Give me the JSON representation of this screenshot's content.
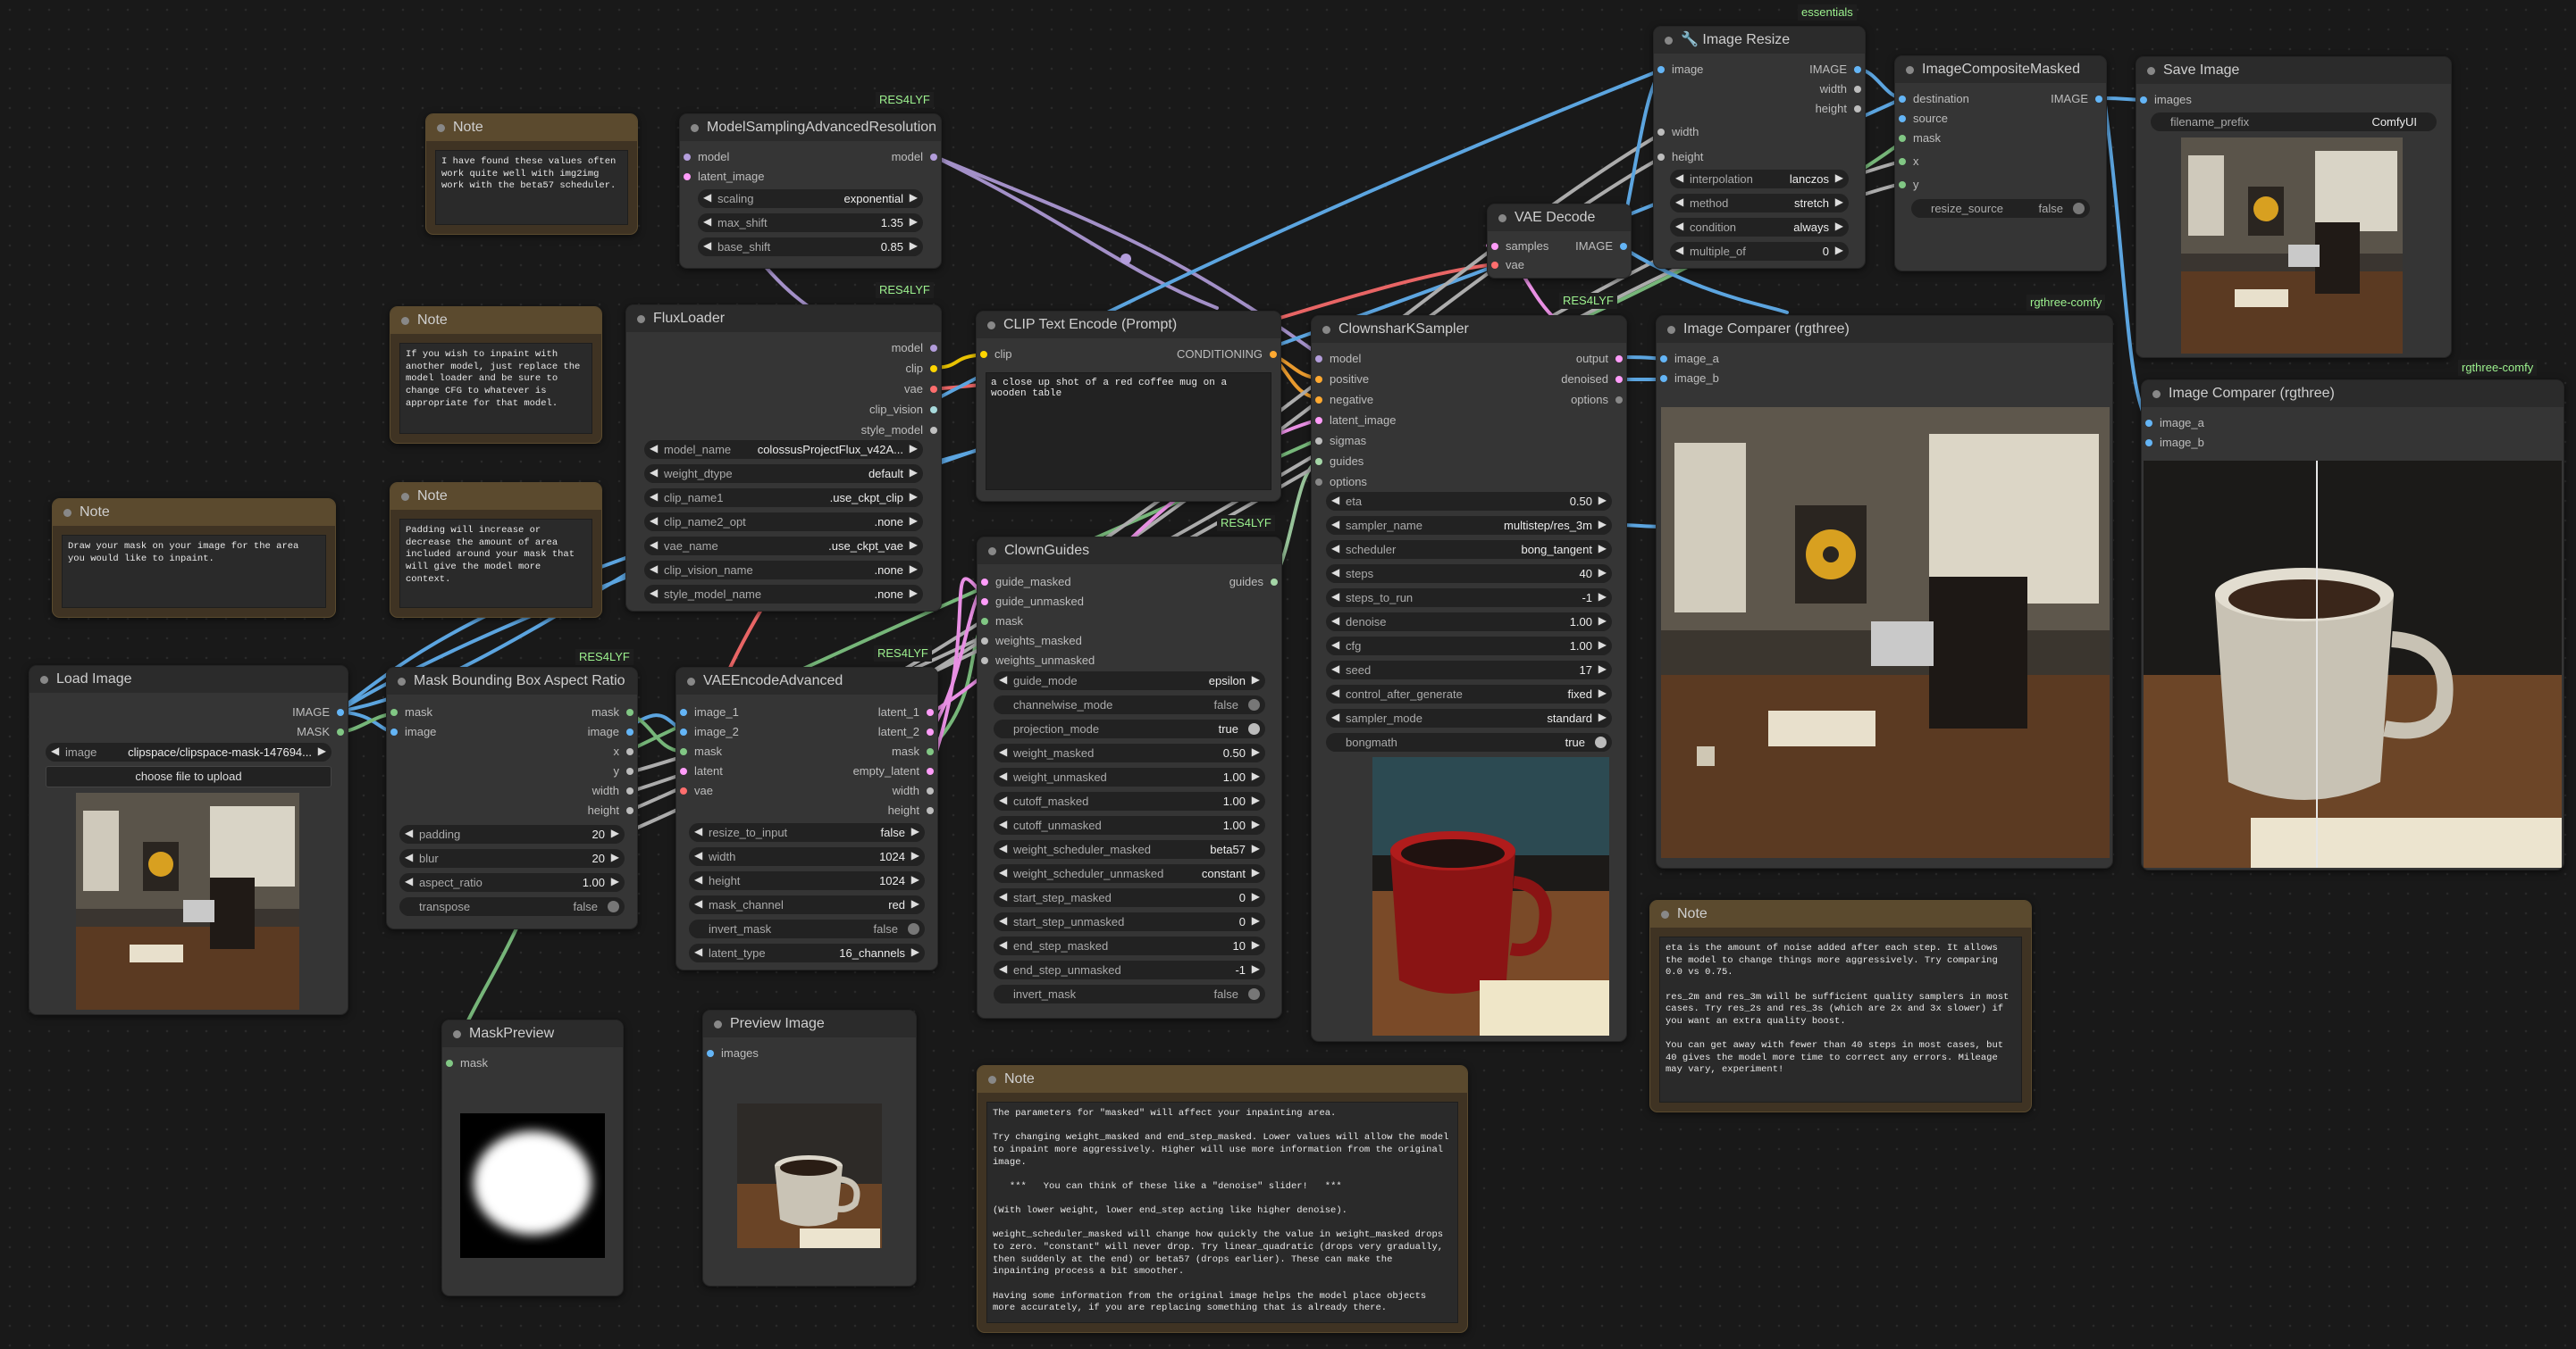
{
  "colors": {
    "image": "#64b5f6",
    "mask": "#81c784",
    "latent": "#ff9cf9",
    "model": "#b39ddb",
    "clip": "#ffd500",
    "vae": "#ff6e6e",
    "conditioning": "#ffa931",
    "guides": "#a5d6a7",
    "int": "#bdbdbd"
  },
  "badges": {
    "res4lyf_1": "RES4LYF",
    "res4lyf_2": "RES4LYF",
    "res4lyf_3": "RES4LYF",
    "res4lyf_4": "RES4LYF",
    "res4lyf_5": "RES4LYF",
    "res4lyf_6": "RES4LYF",
    "essentials": "essentials",
    "rgthree_1": "rgthree-comfy",
    "rgthree_2": "rgthree-comfy"
  },
  "notes": {
    "note1": {
      "title": "Note",
      "text": "I have found these values often work quite well with img2img work with the beta57 scheduler."
    },
    "note2": {
      "title": "Note",
      "text": "If you wish to inpaint with another model, just replace the model loader and be sure to change CFG to whatever is appropriate for that model."
    },
    "note3": {
      "title": "Note",
      "text": "Draw your mask on your image for the area you would like to inpaint."
    },
    "note4": {
      "title": "Note",
      "text": "Padding will increase or decrease the amount of area included around your mask that will give the model more context."
    },
    "note5": {
      "title": "Note",
      "text": "eta is the amount of noise added after each step. It allows the model to change things more aggressively. Try comparing 0.0 vs 0.75.\n\nres_2m and res_3m will be sufficient quality samplers in most cases. Try res_2s and res_3s (which are 2x and 3x slower) if you want an extra quality boost.\n\nYou can get away with fewer than 40 steps in most cases, but 40 gives the model more time to correct any errors. Mileage may vary, experiment!"
    },
    "note6": {
      "title": "Note",
      "text": "The parameters for \"masked\" will affect your inpainting area.\n\nTry changing weight_masked and end_step_masked. Lower values will allow the model to inpaint more aggressively. Higher will use more information from the original image.\n\n   ***   You can think of these like a \"denoise\" slider!   ***\n\n(With lower weight, lower end_step acting like higher denoise).\n\nweight_scheduler_masked will change how quickly the value in weight_masked drops to zero. \"constant\" will never drop. Try linear_quadratic (drops very gradually, then suddenly at the end) or beta57 (drops earlier). These can make the inpainting process a bit smoother.\n\nHaving some information from the original image helps the model place objects more accurately, if you are replacing something that is already there."
    }
  },
  "model_sampling": {
    "title": "ModelSamplingAdvancedResolution",
    "in_model": "model",
    "in_latent": "latent_image",
    "out_model": "model",
    "widgets": [
      {
        "label": "scaling",
        "value": "exponential"
      },
      {
        "label": "max_shift",
        "value": "1.35"
      },
      {
        "label": "base_shift",
        "value": "0.85"
      }
    ]
  },
  "flux_loader": {
    "title": "FluxLoader",
    "outputs": [
      "model",
      "clip",
      "vae",
      "clip_vision",
      "style_model"
    ],
    "widgets": [
      {
        "label": "model_name",
        "value": "colossusProjectFlux_v42A..."
      },
      {
        "label": "weight_dtype",
        "value": "default"
      },
      {
        "label": "clip_name1",
        "value": ".use_ckpt_clip"
      },
      {
        "label": "clip_name2_opt",
        "value": ".none"
      },
      {
        "label": "vae_name",
        "value": ".use_ckpt_vae"
      },
      {
        "label": "clip_vision_name",
        "value": ".none"
      },
      {
        "label": "style_model_name",
        "value": ".none"
      }
    ]
  },
  "clip_encode": {
    "title": "CLIP Text Encode (Prompt)",
    "in_clip": "clip",
    "out": "CONDITIONING",
    "text": "a close up shot of a red coffee mug on a wooden table"
  },
  "clown_guides": {
    "title": "ClownGuides",
    "inputs": [
      "guide_masked",
      "guide_unmasked",
      "mask",
      "weights_masked",
      "weights_unmasked"
    ],
    "out": "guides",
    "widgets": [
      {
        "label": "guide_mode",
        "value": "epsilon"
      },
      {
        "label": "channelwise_mode",
        "value": "false",
        "toggle": true
      },
      {
        "label": "projection_mode",
        "value": "true",
        "toggle": true
      },
      {
        "label": "weight_masked",
        "value": "0.50"
      },
      {
        "label": "weight_unmasked",
        "value": "1.00"
      },
      {
        "label": "cutoff_masked",
        "value": "1.00"
      },
      {
        "label": "cutoff_unmasked",
        "value": "1.00"
      },
      {
        "label": "weight_scheduler_masked",
        "value": "beta57"
      },
      {
        "label": "weight_scheduler_unmasked",
        "value": "constant"
      },
      {
        "label": "start_step_masked",
        "value": "0"
      },
      {
        "label": "start_step_unmasked",
        "value": "0"
      },
      {
        "label": "end_step_masked",
        "value": "10"
      },
      {
        "label": "end_step_unmasked",
        "value": "-1"
      },
      {
        "label": "invert_mask",
        "value": "false",
        "toggle": true
      }
    ]
  },
  "load_image": {
    "title": "Load Image",
    "outputs": [
      "IMAGE",
      "MASK"
    ],
    "image_label": "image",
    "image_value": "clipspace/clipspace-mask-147694...",
    "upload": "choose file to upload"
  },
  "mask_bbox": {
    "title": "Mask Bounding Box Aspect Ratio",
    "inputs": [
      "mask",
      "image"
    ],
    "outputs": [
      "mask",
      "image",
      "x",
      "y",
      "width",
      "height"
    ],
    "widgets": [
      {
        "label": "padding",
        "value": "20"
      },
      {
        "label": "blur",
        "value": "20"
      },
      {
        "label": "aspect_ratio",
        "value": "1.00"
      },
      {
        "label": "transpose",
        "value": "false",
        "toggle": true
      }
    ]
  },
  "vae_encode": {
    "title": "VAEEncodeAdvanced",
    "inputs": [
      "image_1",
      "image_2",
      "mask",
      "latent",
      "vae"
    ],
    "outputs": [
      "latent_1",
      "latent_2",
      "mask",
      "empty_latent",
      "width",
      "height"
    ],
    "widgets": [
      {
        "label": "resize_to_input",
        "value": "false"
      },
      {
        "label": "width",
        "value": "1024"
      },
      {
        "label": "height",
        "value": "1024"
      },
      {
        "label": "mask_channel",
        "value": "red"
      },
      {
        "label": "invert_mask",
        "value": "false",
        "toggle": true
      },
      {
        "label": "latent_type",
        "value": "16_channels"
      }
    ]
  },
  "mask_preview": {
    "title": "MaskPreview",
    "input": "mask"
  },
  "preview_image": {
    "title": "Preview Image",
    "input": "images"
  },
  "ksampler": {
    "title": "ClownsharKSampler",
    "inputs": [
      "model",
      "positive",
      "negative",
      "latent_image",
      "sigmas",
      "guides",
      "options"
    ],
    "outputs": [
      "output",
      "denoised",
      "options"
    ],
    "widgets": [
      {
        "label": "eta",
        "value": "0.50"
      },
      {
        "label": "sampler_name",
        "value": "multistep/res_3m"
      },
      {
        "label": "scheduler",
        "value": "bong_tangent"
      },
      {
        "label": "steps",
        "value": "40"
      },
      {
        "label": "steps_to_run",
        "value": "-1"
      },
      {
        "label": "denoise",
        "value": "1.00"
      },
      {
        "label": "cfg",
        "value": "1.00"
      },
      {
        "label": "seed",
        "value": "17"
      },
      {
        "label": "control_after_generate",
        "value": "fixed"
      },
      {
        "label": "sampler_mode",
        "value": "standard"
      },
      {
        "label": "bongmath",
        "value": "true",
        "toggle": true
      }
    ]
  },
  "vae_decode": {
    "title": "VAE Decode",
    "inputs": [
      "samples",
      "vae"
    ],
    "out": "IMAGE"
  },
  "image_resize": {
    "title": "🔧 Image Resize",
    "input": "image",
    "outputs": [
      "IMAGE",
      "width",
      "height"
    ],
    "inputs2": [
      "width",
      "height"
    ],
    "widgets": [
      {
        "label": "interpolation",
        "value": "lanczos"
      },
      {
        "label": "method",
        "value": "stretch"
      },
      {
        "label": "condition",
        "value": "always"
      },
      {
        "label": "multiple_of",
        "value": "0"
      }
    ]
  },
  "composite": {
    "title": "ImageCompositeMasked",
    "inputs": [
      "destination",
      "source",
      "mask",
      "x",
      "y"
    ],
    "out": "IMAGE",
    "widget": {
      "label": "resize_source",
      "value": "false"
    }
  },
  "save_image": {
    "title": "Save Image",
    "input": "images",
    "widget": {
      "label": "filename_prefix",
      "value": "ComfyUI"
    }
  },
  "comparer1": {
    "title": "Image Comparer (rgthree)",
    "inputs": [
      "image_a",
      "image_b"
    ]
  },
  "comparer2": {
    "title": "Image Comparer (rgthree)",
    "inputs": [
      "image_a",
      "image_b"
    ]
  }
}
